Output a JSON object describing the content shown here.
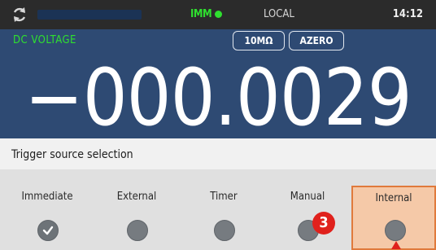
{
  "status": {
    "trigger_mode": "IMM",
    "remote_state": "LOCAL",
    "time": "14:12"
  },
  "measurement": {
    "function": "DC VOLTAGE",
    "impedance": "10MΩ",
    "autozero": "AZERO",
    "reading": "−000.0029"
  },
  "trigger_panel": {
    "title": "Trigger source selection",
    "options": [
      {
        "label": "Immediate",
        "checked": true
      },
      {
        "label": "External",
        "checked": false
      },
      {
        "label": "Timer",
        "checked": false
      },
      {
        "label": "Manual",
        "checked": false
      },
      {
        "label": "Internal",
        "checked": false
      }
    ]
  },
  "annotation": {
    "step_number": "3",
    "color": "#e0211c"
  },
  "colors": {
    "screen_bg": "#2e4a73",
    "status_bg": "#2b2b2b",
    "accent_green": "#2fe02f",
    "highlight": "#f5c9a8"
  }
}
